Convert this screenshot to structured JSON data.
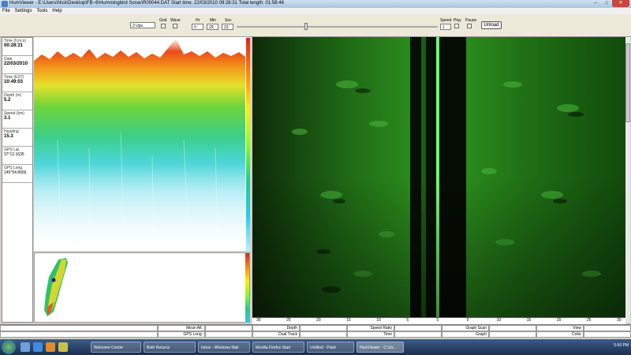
{
  "window": {
    "title": "HumViewer - E:\\Users\\Nick\\Desktop\\FB~6\\Hummingbird Sonar\\R00044.DAT    Start time: 22/03/2010 09:28:31    Total length: 01:58:46",
    "buttons": [
      "–",
      "□",
      "✕"
    ]
  },
  "menu": [
    "File",
    "Settings",
    "Tools",
    "Help"
  ],
  "toolbar": {
    "channel_value": "2 Ups",
    "grid_label": "Grid",
    "wave_label": "Wave",
    "hr_label": "Hr",
    "min_label": "Min",
    "sec_label": "Sec",
    "hr_value": "0",
    "min_value": "29",
    "sec_value": "23",
    "speed_label": "Speed",
    "speed_value": "1",
    "play_label": "Play",
    "pause_label": "Pause",
    "unload_label": "Unload"
  },
  "info": [
    {
      "key": "Time (h:m:s)",
      "value": "00:28:31"
    },
    {
      "key": "Date",
      "value": "22/03/2010"
    },
    {
      "key": "Time (EST)",
      "value": "10:49:03"
    },
    {
      "key": "Depth (m)",
      "value": "5.2"
    },
    {
      "key": "Speed (km)",
      "value": "3.1"
    },
    {
      "key": "Heading",
      "value": "15.3"
    },
    {
      "key": "GPS Lat.",
      "value": "37°12.1635"
    },
    {
      "key": "GPS Long.",
      "value": "145°54.8666"
    }
  ],
  "ruler": {
    "labels": [
      "30",
      "25",
      "20",
      "15",
      "10",
      "5",
      "0",
      "5",
      "10",
      "15",
      "20",
      "25",
      "30"
    ]
  },
  "bottom_table": {
    "row1": [
      "Mean Alt.",
      "Depth",
      "Speed Ratio",
      "Graph Scan",
      "View"
    ],
    "row2": [
      "GPS Long.",
      "Dual Track",
      "Time",
      "Graph",
      "Color"
    ]
  },
  "taskbar": {
    "items": [
      "Welcome Center",
      "Both Returns",
      "Inbox - Windows Mail",
      "Mozilla Firefox Start",
      "Untitled - Paint",
      "HumViewer - C:\\Us..."
    ],
    "clock": "5:50 PM"
  },
  "colors": {
    "sonar_green": "#1b7a13",
    "titlebar": "#a9c4e2",
    "taskbar": "#1b2f4f"
  }
}
